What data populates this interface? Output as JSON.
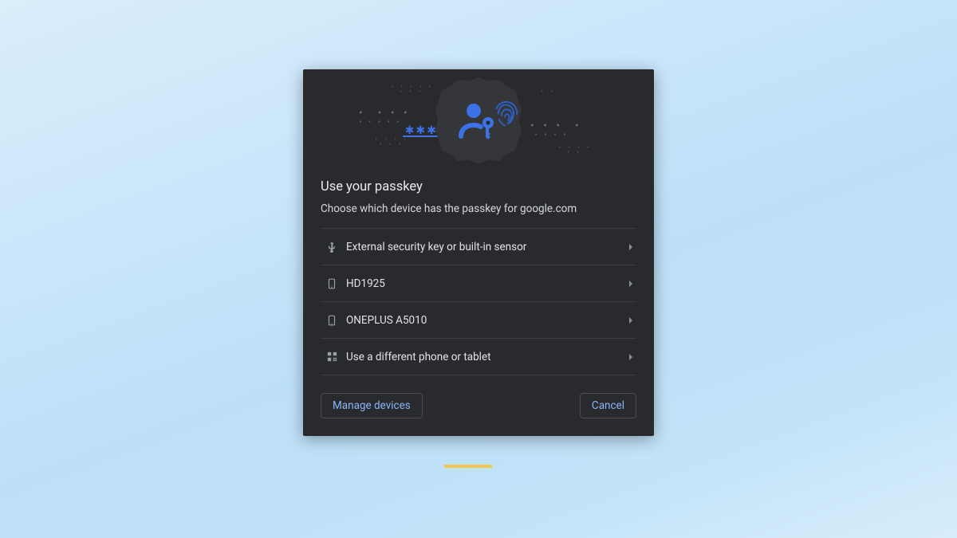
{
  "dialog": {
    "title": "Use your passkey",
    "subtitle": "Choose which device has the passkey for google.com",
    "options": [
      {
        "icon": "usb-icon",
        "label": "External security key or built-in sensor"
      },
      {
        "icon": "phone-icon",
        "label": "HD1925"
      },
      {
        "icon": "phone-icon",
        "label": "ONEPLUS A5010"
      },
      {
        "icon": "qr-icon",
        "label": "Use a different phone or tablet"
      }
    ],
    "manage_label": "Manage devices",
    "cancel_label": "Cancel"
  },
  "colors": {
    "accent": "#8ab4f8",
    "hero_blue": "#3d72e6",
    "panel": "#292a2d"
  }
}
